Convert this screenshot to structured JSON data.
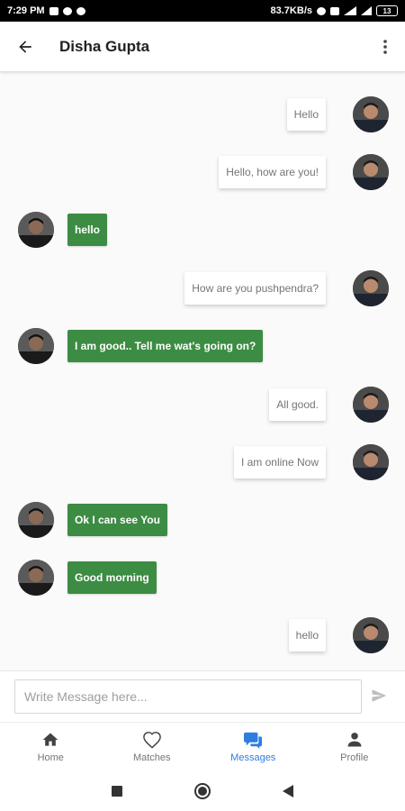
{
  "status_bar": {
    "time": "7:29 PM",
    "network_speed": "83.7KB/s",
    "battery": "13"
  },
  "header": {
    "title": "Disha Gupta",
    "back_icon": "arrow-left-icon",
    "menu_icon": "more-vertical-icon"
  },
  "messages": [
    {
      "type": "sent",
      "text": "Hello"
    },
    {
      "type": "sent",
      "text": "Hello, how are you!"
    },
    {
      "type": "received",
      "text": "hello"
    },
    {
      "type": "sent",
      "text": "How are you pushpendra?"
    },
    {
      "type": "received",
      "text": "I am good.. Tell me wat's going on?"
    },
    {
      "type": "sent",
      "text": "All good."
    },
    {
      "type": "sent",
      "text": "I am online Now"
    },
    {
      "type": "received",
      "text": "Ok I can see You"
    },
    {
      "type": "received",
      "text": "Good morning"
    },
    {
      "type": "sent",
      "text": "hello"
    }
  ],
  "composer": {
    "placeholder": "Write Message here...",
    "value": "",
    "send_icon": "send-icon"
  },
  "bottom_nav": {
    "items": [
      {
        "label": "Home",
        "icon": "home-icon",
        "active": false
      },
      {
        "label": "Matches",
        "icon": "heart-icon",
        "active": false
      },
      {
        "label": "Messages",
        "icon": "chat-icon",
        "active": true
      },
      {
        "label": "Profile",
        "icon": "person-icon",
        "active": false
      }
    ]
  },
  "colors": {
    "received_bubble": "#3c8c43",
    "active_nav": "#2f7de1",
    "inactive_nav": "#757575"
  }
}
